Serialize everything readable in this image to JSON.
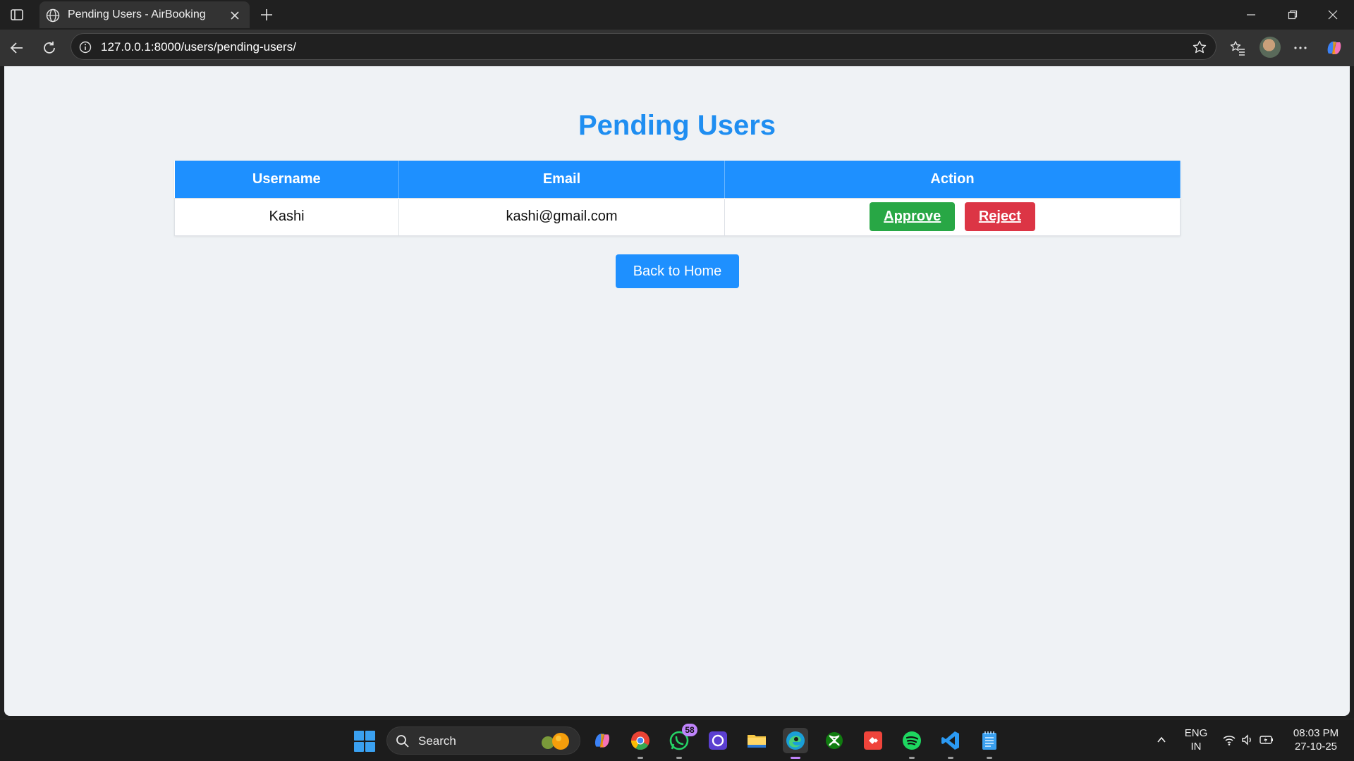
{
  "browser": {
    "tab_title": "Pending Users - AirBooking",
    "url": "127.0.0.1:8000/users/pending-users/"
  },
  "page": {
    "title": "Pending Users",
    "table": {
      "headers": [
        "Username",
        "Email",
        "Action"
      ],
      "rows": [
        {
          "username": "Kashi",
          "email": "kashi@gmail.com",
          "approve_label": "Approve",
          "reject_label": "Reject"
        }
      ]
    },
    "back_label": "Back to Home"
  },
  "taskbar": {
    "search_label": "Search",
    "whatsapp_badge": "58",
    "lang_line1": "ENG",
    "lang_line2": "IN",
    "time": "08:03 PM",
    "date": "27-10-25"
  },
  "colors": {
    "title_blue": "#1f8ef1",
    "header_blue": "#1e90ff",
    "approve_green": "#28a745",
    "reject_red": "#dc3545"
  }
}
